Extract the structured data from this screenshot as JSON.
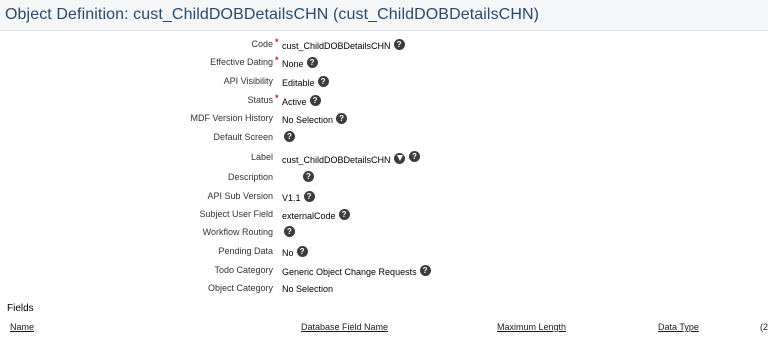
{
  "page_title": "Object Definition: cust_ChildDOBDetailsCHN (cust_ChildDOBDetailsCHN)",
  "fields": {
    "code": {
      "label": "Code",
      "required": "*",
      "value": "cust_ChildDOBDetailsCHN"
    },
    "effective_dating": {
      "label": "Effective Dating",
      "required": "*",
      "value": "None"
    },
    "api_visibility": {
      "label": "API Visibility",
      "value": "Editable"
    },
    "status": {
      "label": "Status",
      "required": "*",
      "value": "Active"
    },
    "mdf_version_history": {
      "label": "MDF Version History",
      "value": "No Selection"
    },
    "default_screen": {
      "label": "Default Screen",
      "value": ""
    },
    "label": {
      "label": "Label",
      "value": "cust_ChildDOBDetailsCHN"
    },
    "description": {
      "label": "Description",
      "value": ""
    },
    "api_sub_version": {
      "label": "API Sub Version",
      "value": "V1.1"
    },
    "subject_user_field": {
      "label": "Subject User Field",
      "value": "externalCode"
    },
    "workflow_routing": {
      "label": "Workflow Routing",
      "value": ""
    },
    "pending_data": {
      "label": "Pending Data",
      "value": "No"
    },
    "todo_category": {
      "label": "Todo Category",
      "value": "Generic Object Change Requests"
    },
    "object_category": {
      "label": "Object Category",
      "value": "No Selection"
    }
  },
  "help_glyph": "?",
  "icons": {
    "help": "question-circle-icon",
    "translate": "translate-icon"
  },
  "colors": {
    "title": "#2b4a6a",
    "required": "#d21a1a",
    "title_bar": "#f4f6f8"
  },
  "fields_section": {
    "title": "Fields",
    "columns": [
      "Name",
      "Database Field Name",
      "Maximum Length",
      "Data Type",
      "(2"
    ]
  }
}
